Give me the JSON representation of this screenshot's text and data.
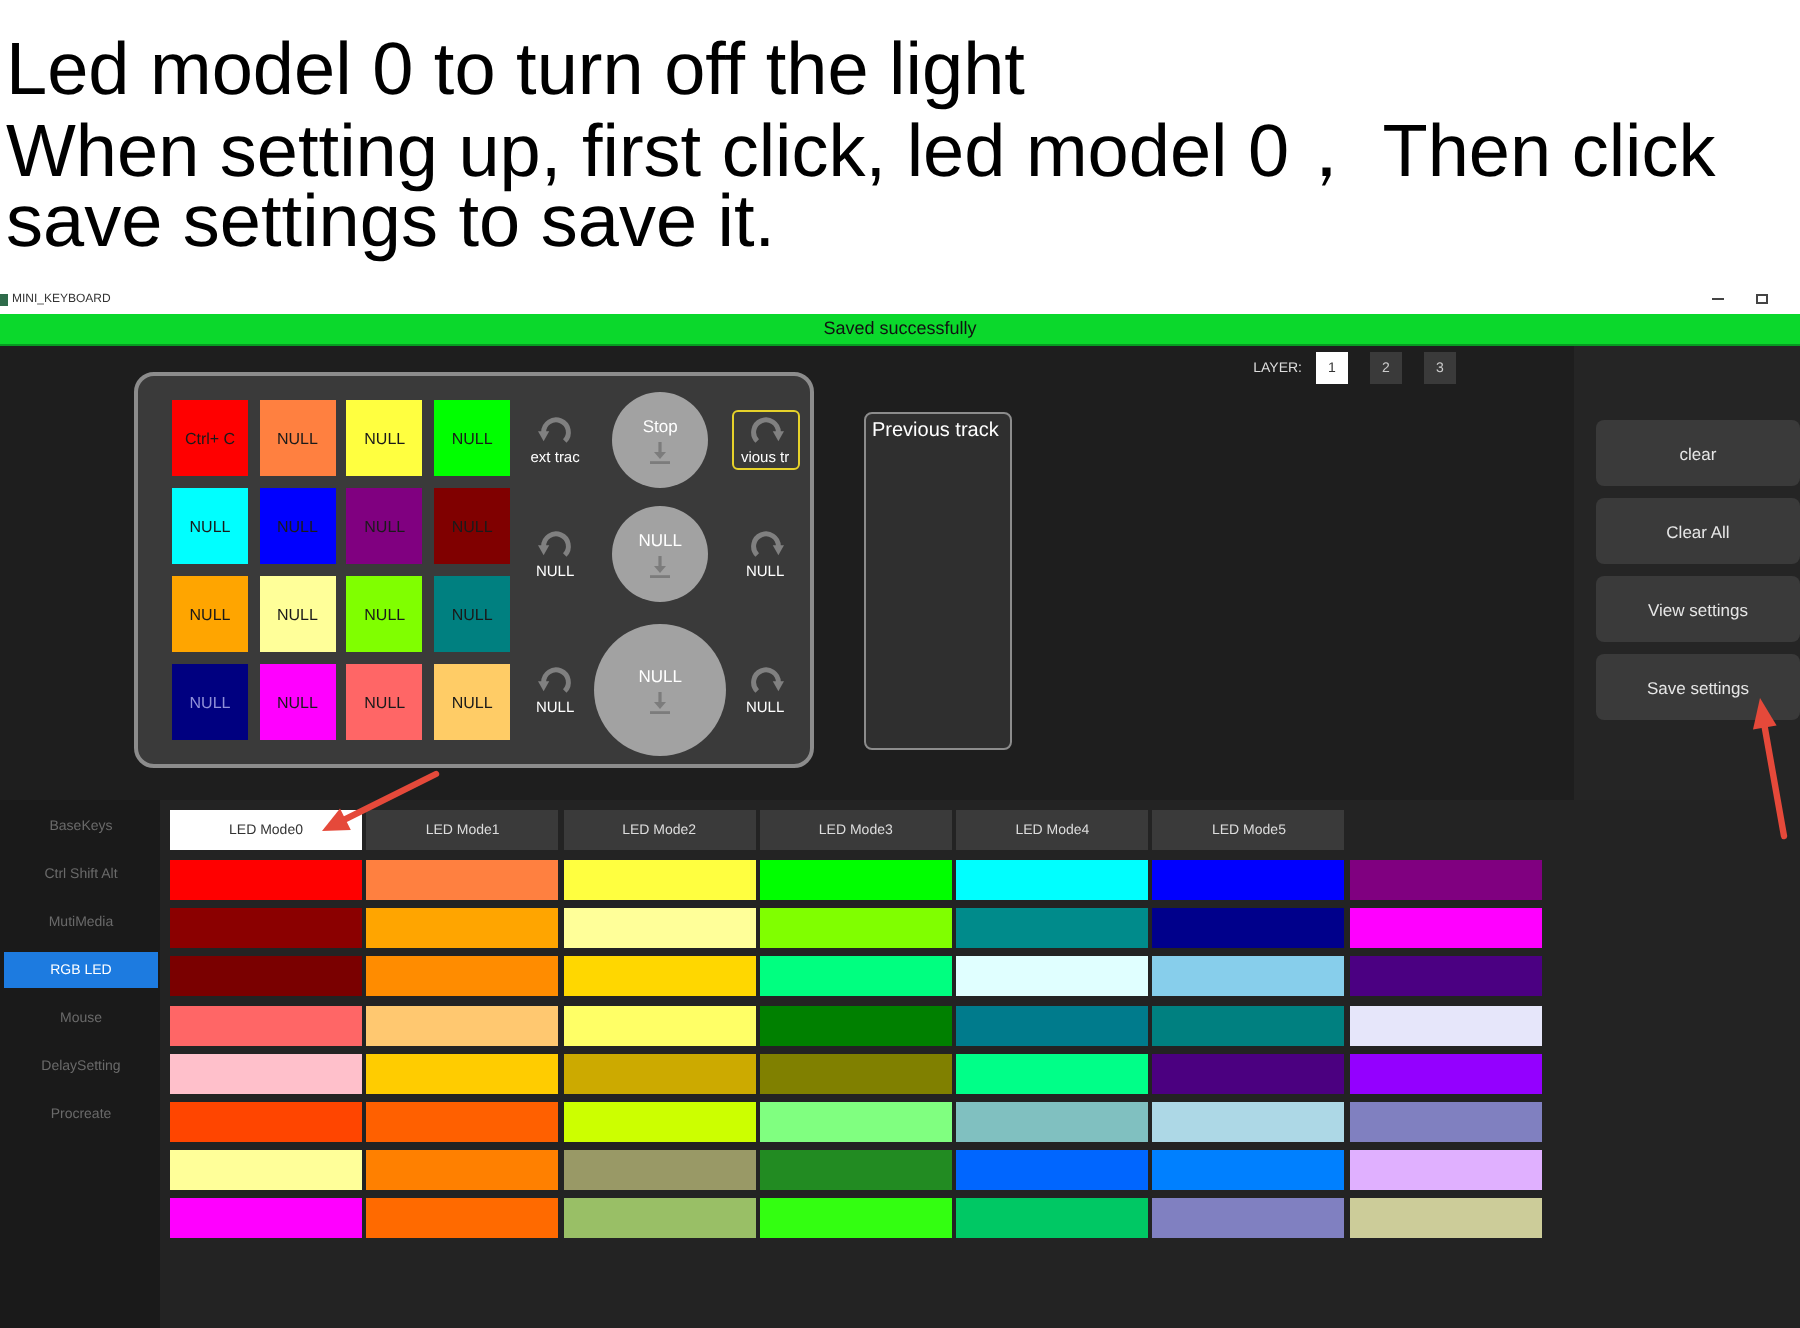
{
  "caption": {
    "heading": "Led model 0 to turn off the light",
    "instruction": "When setting up, first click, led model 0， Then click save settings to save it."
  },
  "window": {
    "title": "MINI_KEYBOARD"
  },
  "status_bar": {
    "message": "Saved successfully"
  },
  "keypad": {
    "keys": [
      {
        "label": "Ctrl+ C",
        "color": "#ff0000",
        "selected": false
      },
      {
        "label": "NULL",
        "color": "#ff8040",
        "selected": false
      },
      {
        "label": "NULL",
        "color": "#ffff40",
        "selected": false
      },
      {
        "label": "NULL",
        "color": "#00ff00",
        "selected": false
      },
      {
        "label": "NULL",
        "color": "#00ffff",
        "selected": false
      },
      {
        "label": "NULL",
        "color": "#0000ff",
        "selected": false
      },
      {
        "label": "NULL",
        "color": "#800080",
        "selected": false
      },
      {
        "label": "NULL",
        "color": "#800000",
        "selected": false
      },
      {
        "label": "NULL",
        "color": "#ffa500",
        "selected": false
      },
      {
        "label": "NULL",
        "color": "#ffff99",
        "selected": false
      },
      {
        "label": "NULL",
        "color": "#80ff00",
        "selected": false
      },
      {
        "label": "NULL",
        "color": "#008080",
        "selected": false
      },
      {
        "label": "NULL",
        "color": "#000080",
        "selected": false
      },
      {
        "label": "NULL",
        "color": "#ff00ff",
        "selected": false
      },
      {
        "label": "NULL",
        "color": "#ff6666",
        "selected": false
      },
      {
        "label": "NULL",
        "color": "#ffcc66",
        "selected": false
      }
    ]
  },
  "knobs": [
    {
      "kind": "small",
      "rotate_left": {
        "label": "ext trac",
        "selected": false
      },
      "press": {
        "label": "Stop",
        "selected": false
      },
      "rotate_right": {
        "label": "vious tr",
        "selected": true
      }
    },
    {
      "kind": "small",
      "rotate_left": {
        "label": "NULL",
        "selected": false
      },
      "press": {
        "label": "NULL",
        "selected": false
      },
      "rotate_right": {
        "label": "NULL",
        "selected": false
      }
    },
    {
      "kind": "large",
      "rotate_left": {
        "label": "NULL",
        "selected": false
      },
      "press": {
        "label": "NULL",
        "selected": false
      },
      "rotate_right": {
        "label": "NULL",
        "selected": false
      }
    }
  ],
  "assigned_function": {
    "text": "Previous track"
  },
  "layer": {
    "label": "LAYER:",
    "options": [
      {
        "label": "1",
        "selected": true
      },
      {
        "label": "2",
        "selected": false
      },
      {
        "label": "3",
        "selected": false
      }
    ]
  },
  "actions": [
    "clear",
    "Clear All",
    "View settings",
    "Save settings"
  ],
  "sidebar": {
    "items": [
      {
        "label": "BaseKeys",
        "selected": false
      },
      {
        "label": "Ctrl Shift Alt",
        "selected": false
      },
      {
        "label": "MutiMedia",
        "selected": false
      },
      {
        "label": "RGB LED",
        "selected": true
      },
      {
        "label": "Mouse",
        "selected": false
      },
      {
        "label": "DelaySetting",
        "selected": false
      },
      {
        "label": "Procreate",
        "selected": false
      }
    ]
  },
  "led_modes": {
    "tabs": [
      {
        "label": "LED Mode0",
        "selected": true
      },
      {
        "label": "LED Mode1",
        "selected": false
      },
      {
        "label": "LED Mode2",
        "selected": false
      },
      {
        "label": "LED Mode3",
        "selected": false
      },
      {
        "label": "LED Mode4",
        "selected": false
      },
      {
        "label": "LED Mode5",
        "selected": false
      }
    ],
    "swatch_rows": [
      {
        "swatches": [
          {
            "color": "#ff0000"
          },
          {
            "color": "#ff8040"
          },
          {
            "color": "#ffff40"
          },
          {
            "color": "#00ff00"
          },
          {
            "color": "#00ffff"
          },
          {
            "color": "#0000ff"
          },
          {
            "color": "#800080"
          }
        ]
      },
      {
        "swatches": [
          {
            "color": "#8b0000"
          },
          {
            "color": "#ffa500"
          },
          {
            "color": "#ffff99"
          },
          {
            "color": "#80ff00"
          },
          {
            "color": "#008b8b"
          },
          {
            "color": "#00008b"
          },
          {
            "color": "#ff00ff"
          }
        ]
      },
      {
        "swatches": [
          {
            "color": "#7a0000"
          },
          {
            "color": "#ff8c00"
          },
          {
            "color": "#ffd700"
          },
          {
            "color": "#00ff80"
          },
          {
            "color": "#e0ffff"
          },
          {
            "color": "#87ceeb"
          },
          {
            "color": "#4b0082"
          }
        ]
      },
      {
        "swatches": [
          {
            "color": "#ff6666"
          },
          {
            "color": "#ffc870"
          },
          {
            "color": "#ffff66"
          },
          {
            "color": "#008000"
          },
          {
            "color": "#007b8c"
          },
          {
            "color": "#008080"
          },
          {
            "color": "#e6e6fa"
          }
        ]
      },
      {
        "swatches": [
          {
            "color": "#ffc0cb"
          },
          {
            "color": "#ffcc00"
          },
          {
            "color": "#ccaa00"
          },
          {
            "color": "#808000"
          },
          {
            "color": "#00ff88"
          },
          {
            "color": "#4b0080"
          },
          {
            "color": "#9400ff"
          }
        ]
      },
      {
        "swatches": [
          {
            "color": "#ff4500"
          },
          {
            "color": "#ff6000"
          },
          {
            "color": "#ccff00"
          },
          {
            "color": "#80ff80"
          },
          {
            "color": "#80c0c0"
          },
          {
            "color": "#add8e6"
          },
          {
            "color": "#8080c0"
          }
        ]
      },
      {
        "swatches": [
          {
            "color": "#ffff99"
          },
          {
            "color": "#ff8000"
          },
          {
            "color": "#999966"
          },
          {
            "color": "#228b22"
          },
          {
            "color": "#0066ff"
          },
          {
            "color": "#0080ff"
          },
          {
            "color": "#e0b0ff"
          }
        ]
      },
      {
        "swatches": [
          {
            "color": "#ff00ff"
          },
          {
            "color": "#ff6a00"
          },
          {
            "color": "#99bf66"
          },
          {
            "color": "#33ff11"
          },
          {
            "color": "#00c864"
          },
          {
            "color": "#8080c1"
          },
          {
            "color": "#cccc99"
          }
        ]
      }
    ]
  }
}
